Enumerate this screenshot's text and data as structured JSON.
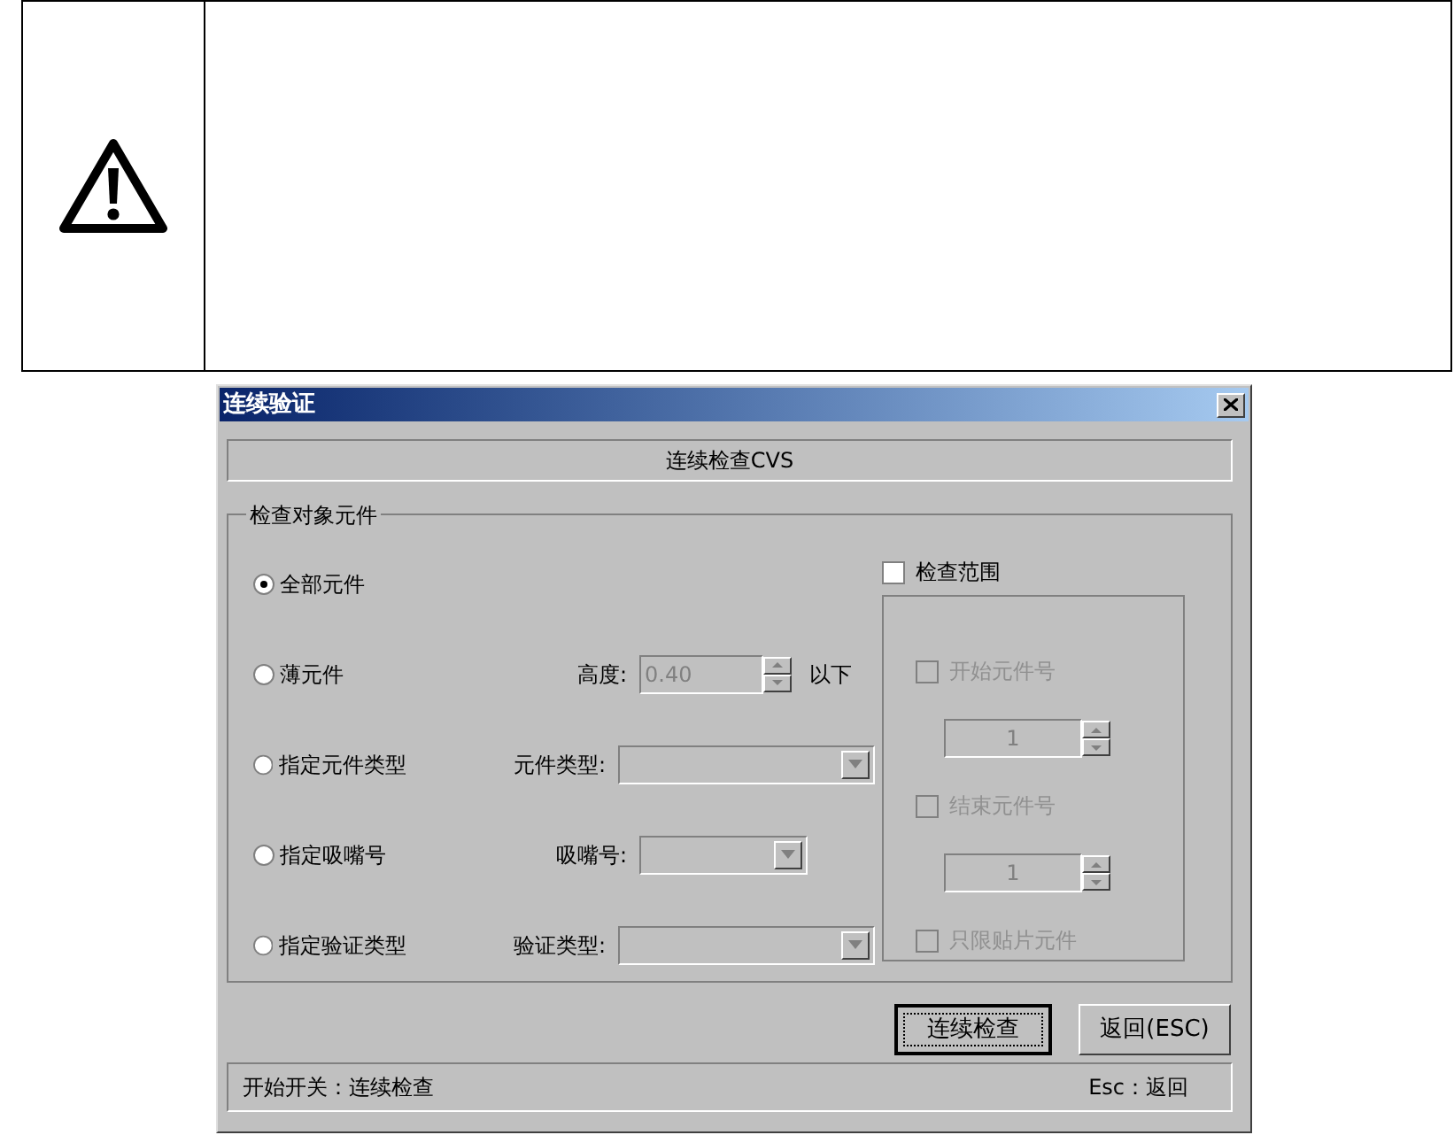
{
  "dialog": {
    "title": "连续验证",
    "header": "连续检查CVS",
    "group_title": "检查对象元件",
    "options": [
      {
        "label": "全部元件",
        "selected": true,
        "kind": "plain"
      },
      {
        "label": "薄元件",
        "selected": false,
        "kind": "spin",
        "field_label": "高度:",
        "value": "0.40",
        "suffix": "以下",
        "disabled": true
      },
      {
        "label": "指定元件类型",
        "selected": false,
        "kind": "combo",
        "field_label": "元件类型:",
        "disabled": true
      },
      {
        "label": "指定吸嘴号",
        "selected": false,
        "kind": "short_combo",
        "field_label": "吸嘴号:",
        "disabled": true
      },
      {
        "label": "指定验证类型",
        "selected": false,
        "kind": "combo",
        "field_label": "验证类型:",
        "disabled": true
      }
    ],
    "range": {
      "label": "检查范围",
      "checked": false,
      "items": [
        {
          "kind": "check",
          "label": "开始元件号",
          "checked": false,
          "disabled": true
        },
        {
          "kind": "spin",
          "value": "1",
          "disabled": true
        },
        {
          "kind": "check",
          "label": "结束元件号",
          "checked": false,
          "disabled": true
        },
        {
          "kind": "spin",
          "value": "1",
          "disabled": true
        },
        {
          "kind": "check",
          "label": "只限贴片元件",
          "checked": false,
          "disabled": true
        }
      ]
    },
    "buttons": [
      {
        "label": "连续检查",
        "default": true
      },
      {
        "label": "返回(ESC)",
        "default": false
      }
    ],
    "status": {
      "left": "开始开关：连续检查",
      "right": "Esc：返回"
    }
  }
}
